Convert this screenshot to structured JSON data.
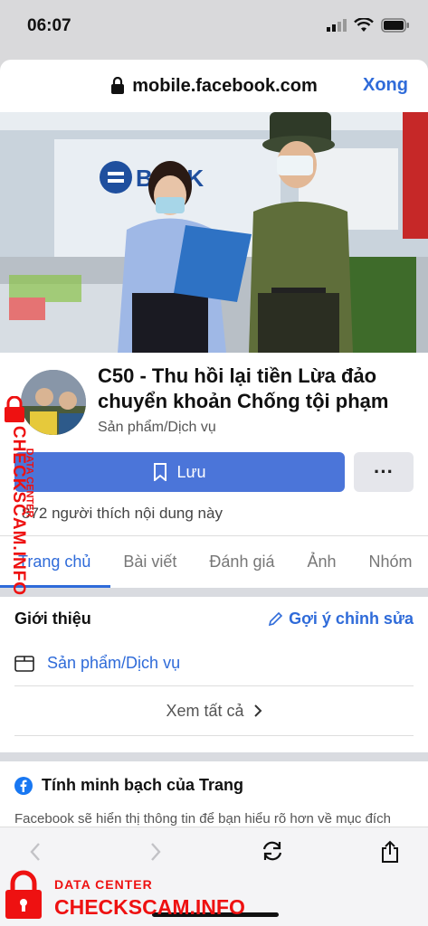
{
  "status": {
    "time": "06:07"
  },
  "browser": {
    "url": "mobile.facebook.com",
    "done_label": "Xong"
  },
  "page": {
    "name": "C50 - Thu hồi lại tiền Lừa đảo chuyển khoản Chống tội phạm",
    "category": "Sản phẩm/Dịch vụ",
    "save_label": "Lưu",
    "more_label": "···",
    "likes_text": "872 người thích nội dung này",
    "cover_sign": "BANK"
  },
  "tabs": [
    {
      "label": "Trang chủ"
    },
    {
      "label": "Bài viết"
    },
    {
      "label": "Đánh giá"
    },
    {
      "label": "Ảnh"
    },
    {
      "label": "Nhóm"
    }
  ],
  "intro": {
    "title": "Giới thiệu",
    "suggest_label": "Gợi ý chỉnh sửa",
    "category_link": "Sản phẩm/Dịch vụ",
    "see_all": "Xem tất cả"
  },
  "transparency": {
    "title": "Tính minh bạch của Trang",
    "body": "Facebook sẽ hiển thị thông tin để bạn hiểu rõ hơn về mục đích của Trang. Hãy xem hành động của những người quản"
  },
  "watermark": {
    "line1": "DATA CENTER",
    "line2": "CHECKSCAM.INFO"
  },
  "colors": {
    "accent": "#2f6bd9",
    "watermark": "#e11111",
    "save_button": "#4b75d9"
  }
}
